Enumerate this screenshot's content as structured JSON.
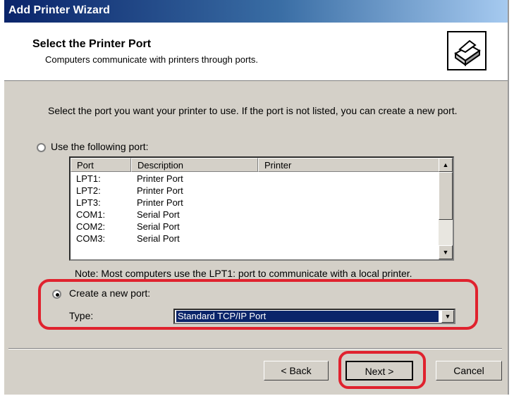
{
  "window": {
    "title": "Add Printer Wizard"
  },
  "header": {
    "title": "Select the Printer Port",
    "subtitle": "Computers communicate with printers through ports.",
    "icon": "printer-wizard-icon"
  },
  "instruction": "Select the port you want your printer to use.  If the port is not listed, you can create a new port.",
  "option_use_port": {
    "label": "Use the following port:",
    "selected": false
  },
  "port_list": {
    "columns": [
      "Port",
      "Description",
      "Printer"
    ],
    "rows": [
      [
        "LPT1:",
        "Printer Port",
        ""
      ],
      [
        "LPT2:",
        "Printer Port",
        ""
      ],
      [
        "LPT3:",
        "Printer Port",
        ""
      ],
      [
        "COM1:",
        "Serial Port",
        ""
      ],
      [
        "COM2:",
        "Serial Port",
        ""
      ],
      [
        "COM3:",
        "Serial Port",
        ""
      ]
    ]
  },
  "note": "Note: Most computers use the LPT1: port to communicate with a local printer.",
  "option_create_port": {
    "label": "Create a new port:",
    "selected": true,
    "type_label": "Type:",
    "type_value": "Standard TCP/IP Port"
  },
  "buttons": {
    "back": "< Back",
    "next": "Next >",
    "cancel": "Cancel"
  },
  "colors": {
    "highlight": "#e0222e",
    "titlebar": "#0a246a",
    "selection": "#0a246a"
  }
}
